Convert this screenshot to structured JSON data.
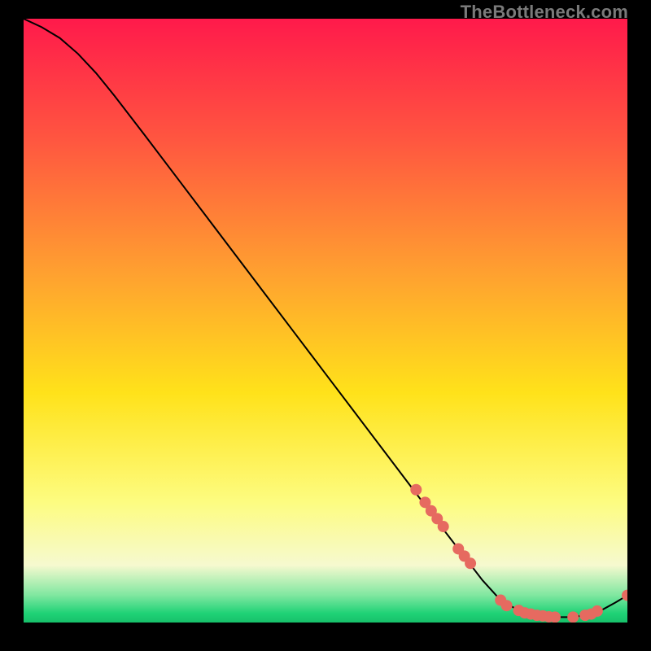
{
  "watermark": "TheBottleneck.com",
  "chart_data": {
    "type": "line",
    "title": "",
    "xlabel": "",
    "ylabel": "",
    "xlim": [
      0,
      100
    ],
    "ylim": [
      0,
      100
    ],
    "grid": false,
    "legend": false,
    "background": "rainbow-vertical-gradient",
    "background_stops": [
      {
        "pos": 0.0,
        "color": "#ff1a4b"
      },
      {
        "pos": 0.2,
        "color": "#ff5640"
      },
      {
        "pos": 0.42,
        "color": "#ffa030"
      },
      {
        "pos": 0.62,
        "color": "#ffe21a"
      },
      {
        "pos": 0.8,
        "color": "#fdfc80"
      },
      {
        "pos": 0.905,
        "color": "#f6f9cf"
      },
      {
        "pos": 0.955,
        "color": "#7fe7a0"
      },
      {
        "pos": 0.985,
        "color": "#1fd276"
      },
      {
        "pos": 1.0,
        "color": "#17c06a"
      }
    ],
    "series": [
      {
        "name": "bottleneck-curve",
        "color": "#000000",
        "x": [
          0,
          3,
          6,
          9,
          12,
          15,
          20,
          25,
          30,
          35,
          40,
          45,
          50,
          55,
          60,
          65,
          68,
          72,
          76,
          79,
          82,
          85,
          88,
          91,
          93.5,
          96,
          98,
          100
        ],
        "y": [
          100,
          98.6,
          96.8,
          94.2,
          91.0,
          87.3,
          80.8,
          74.2,
          67.6,
          61.0,
          54.4,
          47.8,
          41.2,
          34.6,
          28.0,
          21.4,
          17.4,
          12.2,
          7.0,
          3.7,
          2.0,
          1.2,
          0.9,
          0.9,
          1.3,
          2.2,
          3.3,
          4.5
        ]
      }
    ],
    "scatter": {
      "name": "data-points",
      "color": "#e66a60",
      "radius_px": 7,
      "points": [
        {
          "x": 65.0,
          "y": 22.0
        },
        {
          "x": 66.5,
          "y": 19.9
        },
        {
          "x": 67.5,
          "y": 18.5
        },
        {
          "x": 68.5,
          "y": 17.2
        },
        {
          "x": 69.5,
          "y": 15.9
        },
        {
          "x": 72.0,
          "y": 12.2
        },
        {
          "x": 73.0,
          "y": 11.0
        },
        {
          "x": 74.0,
          "y": 9.8
        },
        {
          "x": 79.0,
          "y": 3.7
        },
        {
          "x": 80.0,
          "y": 2.8
        },
        {
          "x": 82.0,
          "y": 2.0
        },
        {
          "x": 83.0,
          "y": 1.6
        },
        {
          "x": 84.0,
          "y": 1.4
        },
        {
          "x": 85.0,
          "y": 1.2
        },
        {
          "x": 86.0,
          "y": 1.1
        },
        {
          "x": 87.0,
          "y": 0.95
        },
        {
          "x": 88.0,
          "y": 0.9
        },
        {
          "x": 91.0,
          "y": 0.9
        },
        {
          "x": 93.0,
          "y": 1.2
        },
        {
          "x": 94.0,
          "y": 1.4
        },
        {
          "x": 95.0,
          "y": 1.9
        },
        {
          "x": 100.0,
          "y": 4.5
        }
      ]
    }
  }
}
